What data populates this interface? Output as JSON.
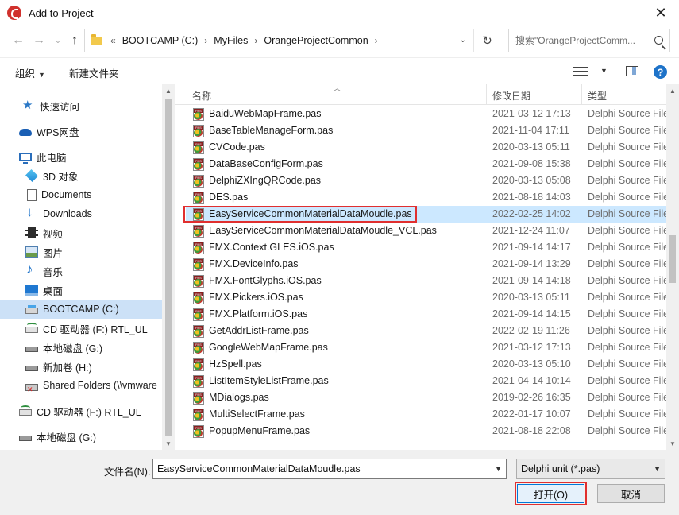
{
  "window": {
    "title": "Add to Project",
    "close_glyph": "✕"
  },
  "address": {
    "lead": "«",
    "crumbs": [
      "BOOTCAMP (C:)",
      "MyFiles",
      "OrangeProjectCommon"
    ],
    "sep": "›",
    "search_placeholder": "搜索\"OrangeProjectComm..."
  },
  "toolbar": {
    "organize": "组织",
    "new_folder": "新建文件夹"
  },
  "nav": {
    "items": [
      {
        "label": "快速访问",
        "icon": "star-icon"
      },
      {
        "label": "WPS网盘",
        "icon": "cloud-icon"
      },
      {
        "label": "此电脑",
        "icon": "computer-icon"
      },
      {
        "label": "3D 对象",
        "icon": "3d-objects-icon"
      },
      {
        "label": "Documents",
        "icon": "documents-icon"
      },
      {
        "label": "Downloads",
        "icon": "downloads-icon"
      },
      {
        "label": "视频",
        "icon": "video-icon"
      },
      {
        "label": "图片",
        "icon": "pictures-icon"
      },
      {
        "label": "音乐",
        "icon": "music-icon"
      },
      {
        "label": "桌面",
        "icon": "desktop-icon"
      },
      {
        "label": "BOOTCAMP (C:)",
        "icon": "drive-icon"
      },
      {
        "label": "CD 驱动器 (F:) RTL_UL",
        "icon": "cd-drive-icon"
      },
      {
        "label": "本地磁盘 (G:)",
        "icon": "disk-icon"
      },
      {
        "label": "新加卷 (H:)",
        "icon": "disk-icon"
      },
      {
        "label": "Shared Folders (\\\\vmware",
        "icon": "network-drive-icon"
      },
      {
        "label": "CD 驱动器 (F:) RTL_UL",
        "icon": "cd-drive-icon"
      },
      {
        "label": "本地磁盘 (G:)",
        "icon": "disk-icon"
      }
    ]
  },
  "columns": {
    "name": "名称",
    "date": "修改日期",
    "type": "类型"
  },
  "files": [
    {
      "name": "BaiduWebMapFrame.pas",
      "date": "2021-03-12 17:13",
      "type": "Delphi Source File"
    },
    {
      "name": "BaseTableManageForm.pas",
      "date": "2021-11-04 17:11",
      "type": "Delphi Source File"
    },
    {
      "name": "CVCode.pas",
      "date": "2020-03-13 05:11",
      "type": "Delphi Source File"
    },
    {
      "name": "DataBaseConfigForm.pas",
      "date": "2021-09-08 15:38",
      "type": "Delphi Source File"
    },
    {
      "name": "DelphiZXIngQRCode.pas",
      "date": "2020-03-13 05:08",
      "type": "Delphi Source File"
    },
    {
      "name": "DES.pas",
      "date": "2021-08-18 14:03",
      "type": "Delphi Source File"
    },
    {
      "name": "EasyServiceCommonMaterialDataMoudle.pas",
      "date": "2022-02-25 14:02",
      "type": "Delphi Source File"
    },
    {
      "name": "EasyServiceCommonMaterialDataMoudle_VCL.pas",
      "date": "2021-12-24 11:07",
      "type": "Delphi Source File"
    },
    {
      "name": "FMX.Context.GLES.iOS.pas",
      "date": "2021-09-14 14:17",
      "type": "Delphi Source File"
    },
    {
      "name": "FMX.DeviceInfo.pas",
      "date": "2021-09-14 13:29",
      "type": "Delphi Source File"
    },
    {
      "name": "FMX.FontGlyphs.iOS.pas",
      "date": "2021-09-14 14:18",
      "type": "Delphi Source File"
    },
    {
      "name": "FMX.Pickers.iOS.pas",
      "date": "2020-03-13 05:11",
      "type": "Delphi Source File"
    },
    {
      "name": "FMX.Platform.iOS.pas",
      "date": "2021-09-14 14:15",
      "type": "Delphi Source File"
    },
    {
      "name": "GetAddrListFrame.pas",
      "date": "2022-02-19 11:26",
      "type": "Delphi Source File"
    },
    {
      "name": "GoogleWebMapFrame.pas",
      "date": "2021-03-12 17:13",
      "type": "Delphi Source File"
    },
    {
      "name": "HzSpell.pas",
      "date": "2020-03-13 05:10",
      "type": "Delphi Source File"
    },
    {
      "name": "ListItemStyleListFrame.pas",
      "date": "2021-04-14 10:14",
      "type": "Delphi Source File"
    },
    {
      "name": "MDialogs.pas",
      "date": "2019-02-26 16:35",
      "type": "Delphi Source File"
    },
    {
      "name": "MultiSelectFrame.pas",
      "date": "2022-01-17 10:07",
      "type": "Delphi Source File"
    },
    {
      "name": "PopupMenuFrame.pas",
      "date": "2021-08-18 22:08",
      "type": "Delphi Source File"
    }
  ],
  "selected_index": 6,
  "filename": {
    "label": "文件名(N):",
    "value": "EasyServiceCommonMaterialDataMoudle.pas"
  },
  "filetype": {
    "value": "Delphi unit (*.pas)"
  },
  "buttons": {
    "open": "打开(O)",
    "cancel": "取消"
  }
}
